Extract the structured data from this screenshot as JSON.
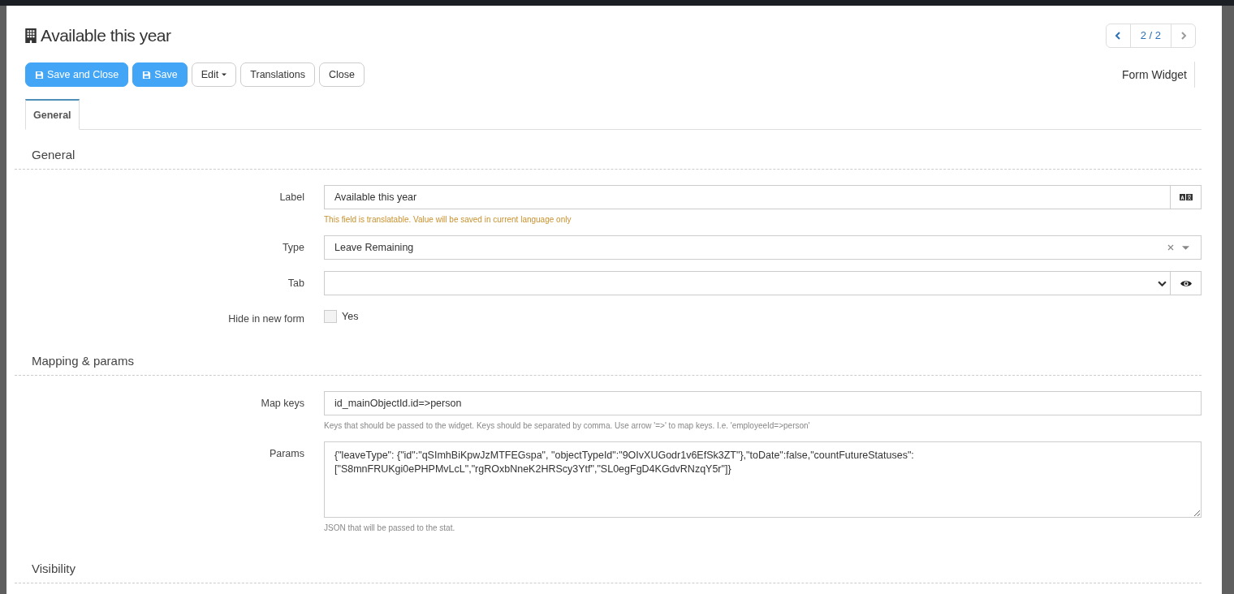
{
  "window": {
    "title": "Available this year"
  },
  "pager": {
    "text": "2 / 2",
    "prev": {
      "disabled": false
    },
    "next": {
      "disabled": true
    }
  },
  "toolbar": [
    {
      "label": "Save and Close",
      "kind": "primary"
    },
    {
      "label": "Save",
      "kind": "primary"
    },
    {
      "label": "Edit",
      "kind": "dropdown"
    },
    {
      "label": "Translations",
      "kind": "default"
    },
    {
      "label": "Close",
      "kind": "default"
    }
  ],
  "context_label": "Form Widget",
  "tabs": [
    {
      "label": "General",
      "selected": true
    }
  ],
  "sections": [
    {
      "title": "General",
      "fields": [
        {
          "label": "Label",
          "kind": "translatable",
          "value": "Available this year",
          "help": "This field is translatable. Value will be saved in current language only"
        },
        {
          "label": "Type",
          "kind": "combo",
          "value": "Leave Remaining"
        },
        {
          "label": "Tab",
          "kind": "select"
        },
        {
          "label": "Hide in new form",
          "kind": "checkbox",
          "option": "Yes",
          "checked": false
        }
      ]
    },
    {
      "title": "Mapping & params",
      "fields": [
        {
          "label": "Map keys",
          "kind": "text",
          "value": "id_mainObjectId.id=>person",
          "help": "Keys that should be passed to the widget. Keys should be separated by comma. Use arrow '=>' to map keys. I.e. 'employeeId=>person'"
        },
        {
          "label": "Params",
          "kind": "textarea",
          "value": "{\"leaveType\": {\"id\":\"qSImhBiKpwJzMTFEGspa\", \"objectTypeId\":\"9OIvXUGodr1v6EfSk3ZT\"},\"toDate\":false,\"countFutureStatuses\": [\"S8mnFRUKgi0ePHPMvLcL\",\"rgROxbNneK2HRScy3Ytf\",\"SL0egFgD4KGdvRNzqY5r\"]}",
          "help": "JSON that will be passed to the stat."
        }
      ]
    },
    {
      "title": "Visibility"
    }
  ]
}
